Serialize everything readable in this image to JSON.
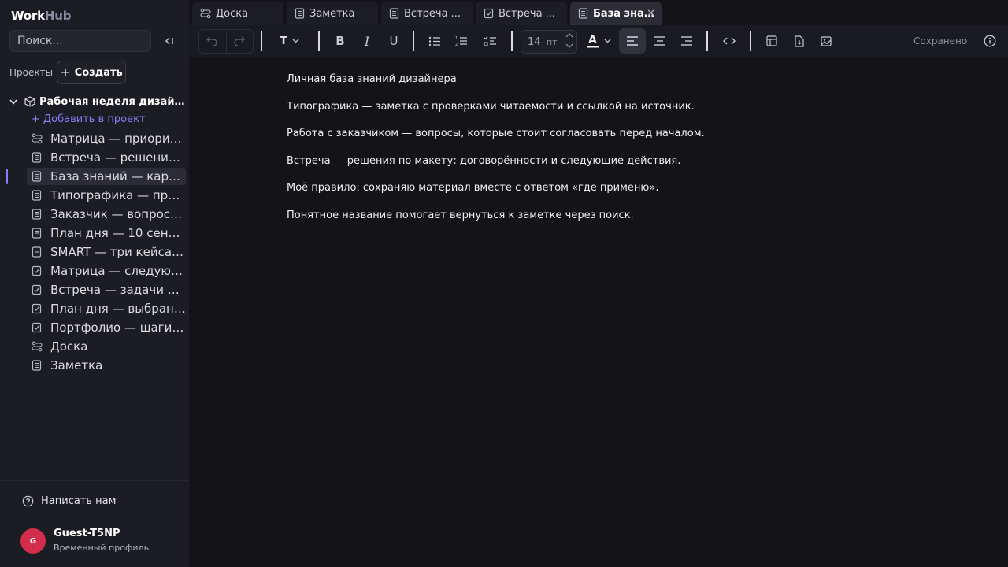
{
  "app": {
    "logo_part1": "Work",
    "logo_part2": "Hub",
    "accent_color": "#8b7cf6"
  },
  "sidebar": {
    "search_placeholder": "Поиск...",
    "projects_label": "Проекты",
    "create_label": "Создать",
    "project_title": "Рабочая неделя дизайнер...",
    "add_to_project": "+ Добавить в проект",
    "items": [
      {
        "label": "Матрица — приорите...",
        "icon": "board-icon"
      },
      {
        "label": "Встреча — решения п...",
        "icon": "note-icon"
      },
      {
        "label": "База знаний — карта ...",
        "icon": "note-icon",
        "active": true
      },
      {
        "label": "Типографика — пров...",
        "icon": "note-icon"
      },
      {
        "label": "Заказчик — вопросы ...",
        "icon": "note-icon"
      },
      {
        "label": "План дня — 10 сентяб...",
        "icon": "note-icon"
      },
      {
        "label": "SMART — три кейса п...",
        "icon": "note-icon"
      },
      {
        "label": "Матрица — следующ...",
        "icon": "task-icon"
      },
      {
        "label": "Встреча — задачи пос...",
        "icon": "task-icon"
      },
      {
        "label": "План дня — выбранн...",
        "icon": "task-icon"
      },
      {
        "label": "Портфолио — шаги к ...",
        "icon": "task-icon"
      },
      {
        "label": "Доска",
        "icon": "board-icon"
      },
      {
        "label": "Заметка",
        "icon": "note-icon"
      }
    ],
    "contact_label": "Написать нам",
    "user": {
      "avatar_letter": "G",
      "name": "Guest-T5NP",
      "subtitle": "Временный профиль",
      "avatar_color": "#d22e4b"
    }
  },
  "tabs": [
    {
      "label": "Доска",
      "icon": "board-icon"
    },
    {
      "label": "Заметка",
      "icon": "note-icon"
    },
    {
      "label": "Встреча ...",
      "icon": "note-icon"
    },
    {
      "label": "Встреча ...",
      "icon": "task-icon"
    },
    {
      "label": "База зна...",
      "icon": "note-icon",
      "active": true
    }
  ],
  "toolbar": {
    "text_style": "T",
    "font_size": "14",
    "font_unit": "пт",
    "status": "Сохранено"
  },
  "editor": {
    "paragraphs": [
      "Личная база знаний дизайнера",
      "Типографика — заметка с проверками читаемости и ссылкой на источник.",
      "Работа с заказчиком — вопросы, которые стоит согласовать перед началом.",
      "Встреча — решения по макету: договорённости и следующие действия.",
      "Моё правило: сохраняю материал вместе с ответом «где применю».",
      "Понятное название помогает вернуться к заметке через поиск."
    ]
  }
}
